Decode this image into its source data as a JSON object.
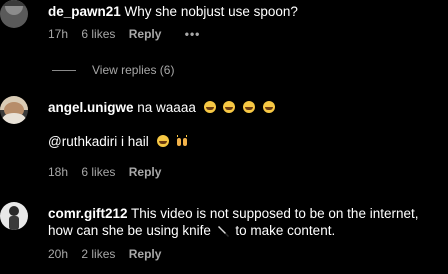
{
  "comments": [
    {
      "username": "de_pawn21",
      "text": "Why she nobjust use spoon?",
      "time": "17h",
      "likes": "6 likes",
      "reply": "Reply",
      "more": "•••",
      "view_replies": "View replies (6)"
    },
    {
      "username": "angel.unigwe",
      "text": "na waaaa",
      "reply_line": "@ruthkadiri i hail",
      "time": "18h",
      "likes": "6 likes",
      "reply": "Reply"
    },
    {
      "username": "comr.gift212",
      "text_1": "This video is not supposed to be on the internet,",
      "text_2a": "how can she be using knife",
      "text_2b": "to make content.",
      "time": "20h",
      "likes": "2 likes",
      "reply": "Reply"
    }
  ],
  "icons": {
    "emoji_laugh": "face-with-tears-of-joy-icon",
    "raising_hands": "raising-hands-icon",
    "knife": "knife-icon"
  },
  "colors": {
    "background": "#000000",
    "text": "#ffffff",
    "meta": "#a8a8a8"
  }
}
